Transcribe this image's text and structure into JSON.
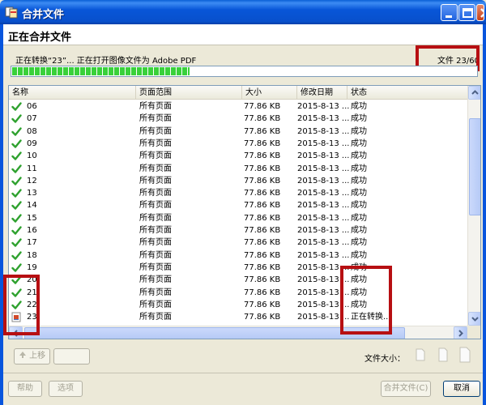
{
  "window": {
    "title": "合并文件"
  },
  "header": {
    "title": "正在合并文件"
  },
  "status": {
    "message": "正在转换“23”... 正在打开图像文件为 Adobe PDF",
    "file_counter": "文件 23/60",
    "progress_fraction": 0.383
  },
  "columns": [
    "名称",
    "页面范围",
    "大小",
    "修改日期",
    "状态"
  ],
  "rows": [
    {
      "name": "06",
      "range": "所有页面",
      "size": "77.86 KB",
      "date": "2015-8-13 ...",
      "status": "成功",
      "icon": "check-icon"
    },
    {
      "name": "07",
      "range": "所有页面",
      "size": "77.86 KB",
      "date": "2015-8-13 ...",
      "status": "成功",
      "icon": "check-icon"
    },
    {
      "name": "08",
      "range": "所有页面",
      "size": "77.86 KB",
      "date": "2015-8-13 ...",
      "status": "成功",
      "icon": "check-icon"
    },
    {
      "name": "09",
      "range": "所有页面",
      "size": "77.86 KB",
      "date": "2015-8-13 ...",
      "status": "成功",
      "icon": "check-icon"
    },
    {
      "name": "10",
      "range": "所有页面",
      "size": "77.86 KB",
      "date": "2015-8-13 ...",
      "status": "成功",
      "icon": "check-icon"
    },
    {
      "name": "11",
      "range": "所有页面",
      "size": "77.86 KB",
      "date": "2015-8-13 ...",
      "status": "成功",
      "icon": "check-icon"
    },
    {
      "name": "12",
      "range": "所有页面",
      "size": "77.86 KB",
      "date": "2015-8-13 ...",
      "status": "成功",
      "icon": "check-icon"
    },
    {
      "name": "13",
      "range": "所有页面",
      "size": "77.86 KB",
      "date": "2015-8-13 ...",
      "status": "成功",
      "icon": "check-icon"
    },
    {
      "name": "14",
      "range": "所有页面",
      "size": "77.86 KB",
      "date": "2015-8-13 ...",
      "status": "成功",
      "icon": "check-icon"
    },
    {
      "name": "15",
      "range": "所有页面",
      "size": "77.86 KB",
      "date": "2015-8-13 ...",
      "status": "成功",
      "icon": "check-icon"
    },
    {
      "name": "16",
      "range": "所有页面",
      "size": "77.86 KB",
      "date": "2015-8-13 ...",
      "status": "成功",
      "icon": "check-icon"
    },
    {
      "name": "17",
      "range": "所有页面",
      "size": "77.86 KB",
      "date": "2015-8-13 ...",
      "status": "成功",
      "icon": "check-icon"
    },
    {
      "name": "18",
      "range": "所有页面",
      "size": "77.86 KB",
      "date": "2015-8-13 ...",
      "status": "成功",
      "icon": "check-icon"
    },
    {
      "name": "19",
      "range": "所有页面",
      "size": "77.86 KB",
      "date": "2015-8-13 ...",
      "status": "成功",
      "icon": "check-icon"
    },
    {
      "name": "20",
      "range": "所有页面",
      "size": "77.86 KB",
      "date": "2015-8-13 ...",
      "status": "成功",
      "icon": "check-icon"
    },
    {
      "name": "21",
      "range": "所有页面",
      "size": "77.86 KB",
      "date": "2015-8-13 ...",
      "status": "成功",
      "icon": "check-icon"
    },
    {
      "name": "22",
      "range": "所有页面",
      "size": "77.86 KB",
      "date": "2015-8-13 ...",
      "status": "成功",
      "icon": "check-icon"
    },
    {
      "name": "23",
      "range": "所有页面",
      "size": "77.86 KB",
      "date": "2015-8-13 ...",
      "status": "正在转换...",
      "icon": "image-file-icon"
    }
  ],
  "buttons": {
    "move_up": "上移",
    "help": "帮助",
    "options": "选项",
    "merge": "合并文件(C)",
    "cancel": "取消"
  },
  "file_size_label": "文件大小：",
  "colors": {
    "title_bar": "#0a5fd6",
    "progress": "#39d13a",
    "highlight": "#b70f12"
  }
}
